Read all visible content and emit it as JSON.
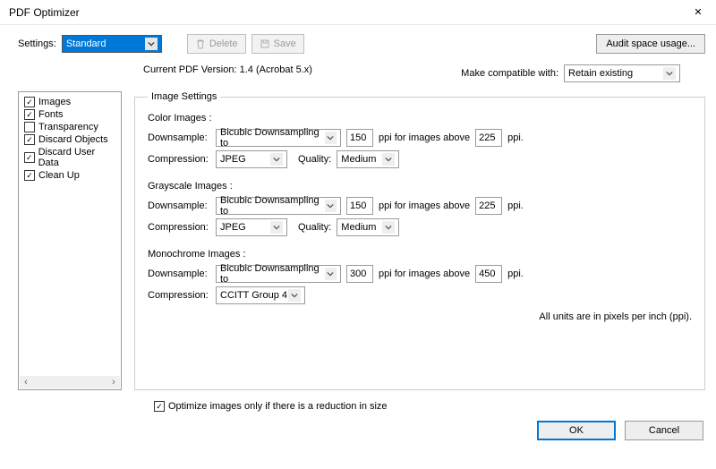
{
  "window": {
    "title": "PDF Optimizer",
    "close": "✕"
  },
  "toolbar": {
    "settings_label": "Settings:",
    "settings_value": "Standard",
    "delete_label": "Delete",
    "save_label": "Save",
    "audit_label": "Audit space usage..."
  },
  "info": {
    "current_version": "Current PDF Version: 1.4 (Acrobat 5.x)",
    "compat_label": "Make compatible with:",
    "compat_value": "Retain existing"
  },
  "categories": [
    {
      "label": "Images",
      "checked": true
    },
    {
      "label": "Fonts",
      "checked": true
    },
    {
      "label": "Transparency",
      "checked": false
    },
    {
      "label": "Discard Objects",
      "checked": true
    },
    {
      "label": "Discard User Data",
      "checked": true
    },
    {
      "label": "Clean Up",
      "checked": true
    }
  ],
  "panel": {
    "legend": "Image Settings",
    "groups": {
      "color": {
        "title": "Color Images :",
        "downsample_label": "Downsample:",
        "downsample_method": "Bicubic Downsampling to",
        "downsample_ppi": "150",
        "above_text": "ppi for images above",
        "above_ppi": "225",
        "ppi_suffix": "ppi.",
        "compression_label": "Compression:",
        "compression_value": "JPEG",
        "quality_label": "Quality:",
        "quality_value": "Medium"
      },
      "gray": {
        "title": "Grayscale Images :",
        "downsample_label": "Downsample:",
        "downsample_method": "Bicubic Downsampling to",
        "downsample_ppi": "150",
        "above_text": "ppi for images above",
        "above_ppi": "225",
        "ppi_suffix": "ppi.",
        "compression_label": "Compression:",
        "compression_value": "JPEG",
        "quality_label": "Quality:",
        "quality_value": "Medium"
      },
      "mono": {
        "title": "Monochrome Images :",
        "downsample_label": "Downsample:",
        "downsample_method": "Bicubic Downsampling to",
        "downsample_ppi": "300",
        "above_text": "ppi for images above",
        "above_ppi": "450",
        "ppi_suffix": "ppi.",
        "compression_label": "Compression:",
        "compression_value": "CCITT Group 4"
      }
    },
    "footnote": "All units are in pixels per inch (ppi)."
  },
  "optimize_only": {
    "label": "Optimize images only if there is a reduction in size",
    "checked": true
  },
  "buttons": {
    "ok": "OK",
    "cancel": "Cancel"
  },
  "glyph": {
    "check": "✓",
    "left": "‹",
    "right": "›"
  }
}
